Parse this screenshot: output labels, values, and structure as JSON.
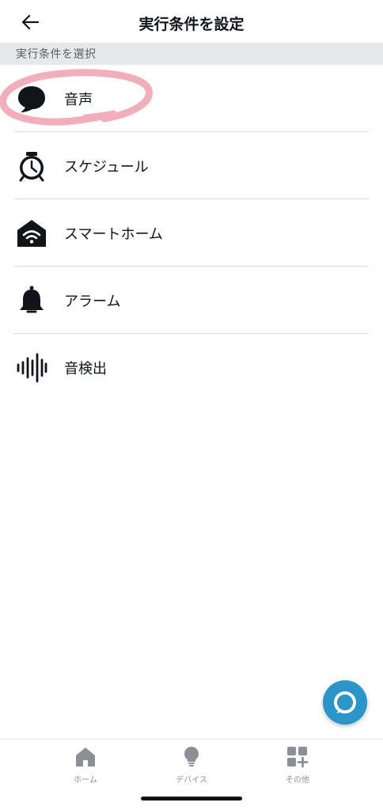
{
  "header": {
    "title": "実行条件を設定",
    "back_icon": "arrow-left-icon"
  },
  "section": {
    "label": "実行条件を選択"
  },
  "list": [
    {
      "label": "音声",
      "icon": "speech-bubble-icon"
    },
    {
      "label": "スケジュール",
      "icon": "alarm-clock-icon"
    },
    {
      "label": "スマートホーム",
      "icon": "smart-home-icon"
    },
    {
      "label": "アラーム",
      "icon": "bell-icon"
    },
    {
      "label": "音検出",
      "icon": "sound-wave-icon"
    }
  ],
  "fab": {
    "icon": "alexa-ring-icon"
  },
  "bottom_nav": [
    {
      "label": "ホーム",
      "icon": "house-icon"
    },
    {
      "label": "デバイス",
      "icon": "lightbulb-icon"
    },
    {
      "label": "その他",
      "icon": "grid-plus-icon"
    }
  ],
  "colors": {
    "accent": "#2b95c9",
    "annotation": "#f2a5b4",
    "section_bg": "#e6e8ea"
  }
}
